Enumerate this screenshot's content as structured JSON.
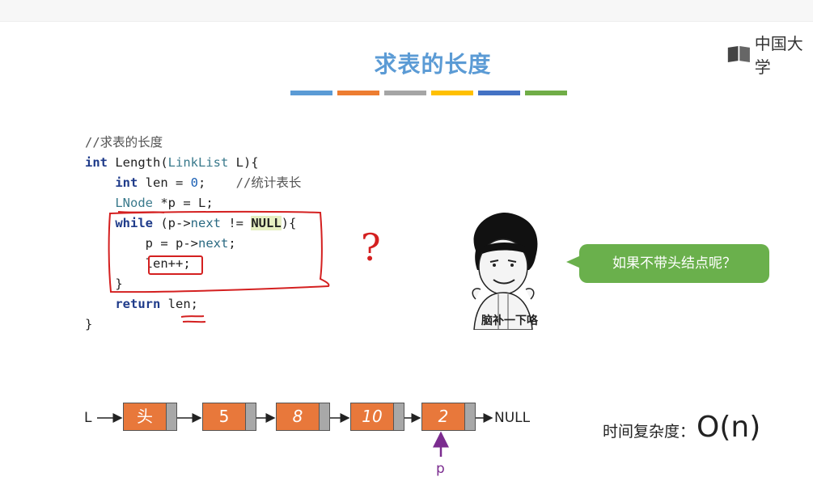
{
  "slide": {
    "title": "求表的长度",
    "title_bar_colors": [
      "#5b9bd5",
      "#ed7d31",
      "#a5a5a5",
      "#ffc000",
      "#4472c4",
      "#70ad47"
    ],
    "logo_text": "中国大学"
  },
  "code": {
    "comment_line": "//求表的长度",
    "line2_kw": "int",
    "line2_rest": " Length(",
    "line2_type": "LinkList",
    "line2_end": " L){",
    "line3_kw": "int",
    "line3_mid": " len = ",
    "line3_num": "0",
    "line3_semi": ";",
    "line3_comment": "    //统计表长",
    "line4_type": "LNode",
    "line4_rest": " *p = L;",
    "line5_kw": "while",
    "line5_a": " (p->",
    "line5_next": "next",
    "line5_b": " != ",
    "line5_null": "NULL",
    "line5_c": "){",
    "line6_a": "p = p->",
    "line6_next": "next",
    "line6_b": ";",
    "line7": "len++;",
    "line8": "}",
    "line9_kw": "return",
    "line9_rest": " len;",
    "line10": "}",
    "question_mark": "?"
  },
  "meme": {
    "caption": "脑补一下咯",
    "bubble_text": "如果不带头结点呢？"
  },
  "linked_list": {
    "head_label": "L",
    "nodes": [
      "头",
      "5",
      "8",
      "10",
      "2"
    ],
    "null_label": "NULL",
    "pointer_label": "p"
  },
  "complexity": {
    "label": "时间复杂度：",
    "value": "O(n)"
  }
}
